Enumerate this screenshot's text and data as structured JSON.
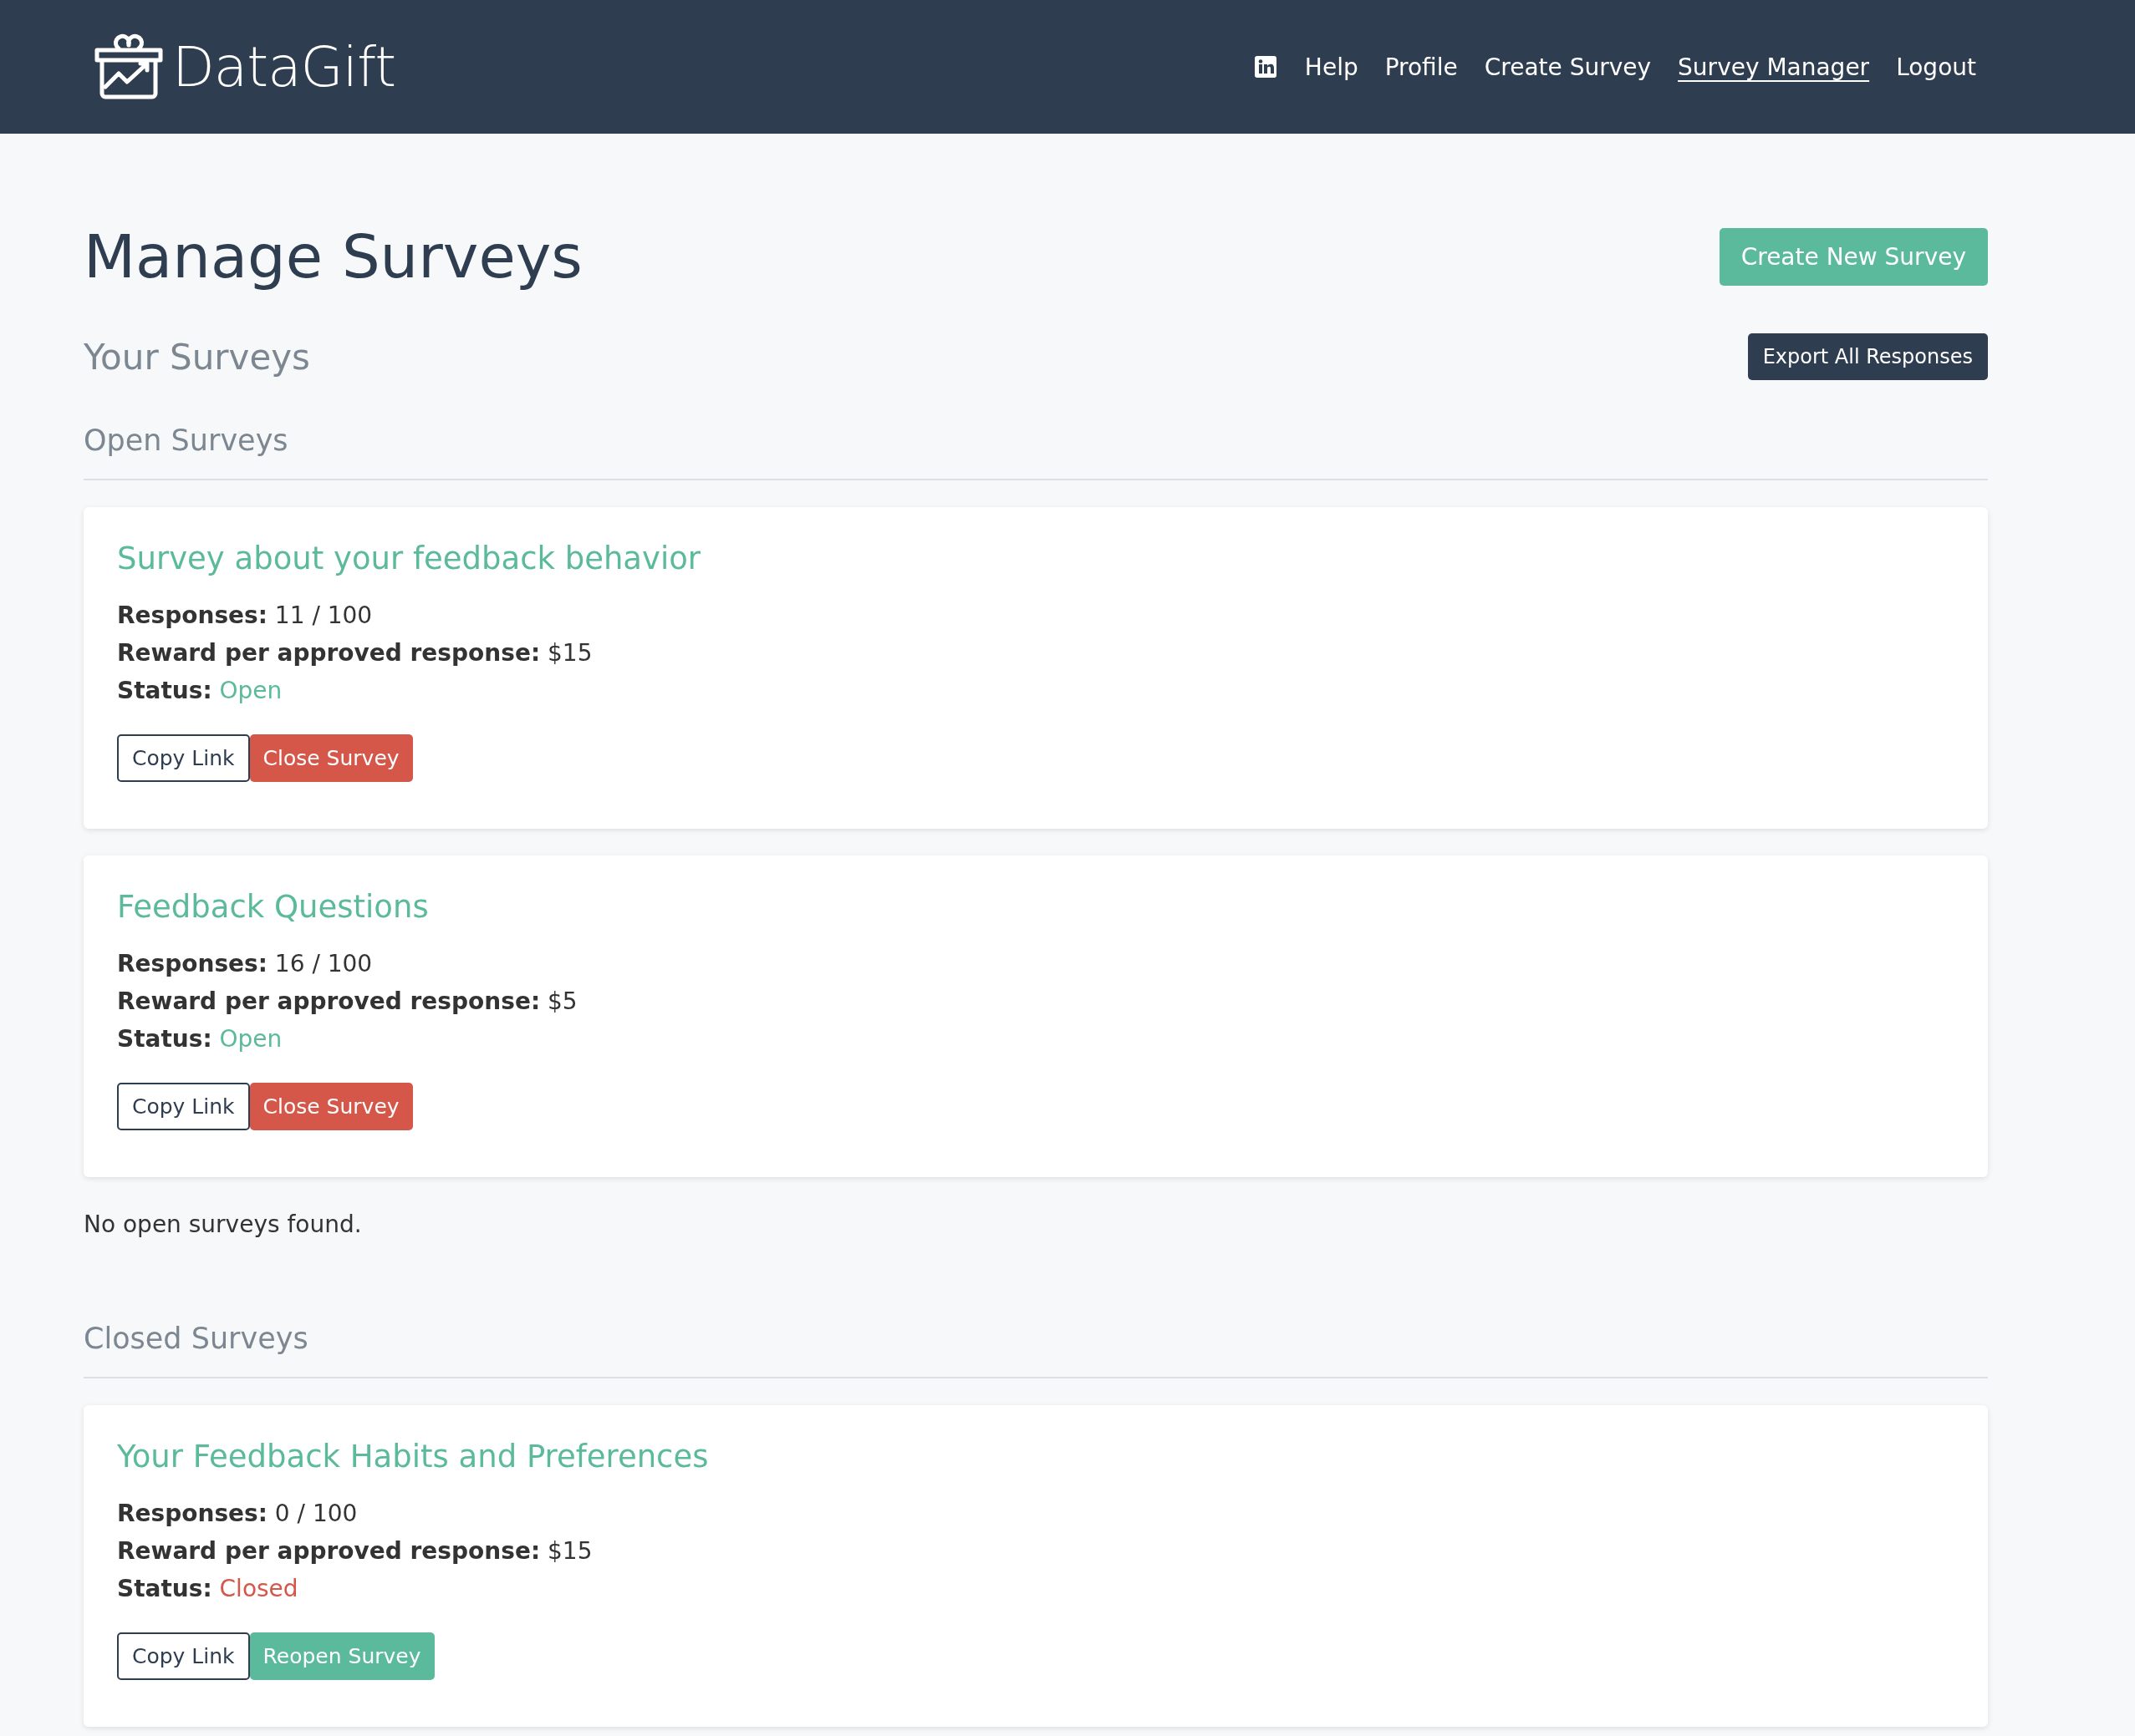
{
  "header": {
    "logo": "DataGift",
    "nav": [
      {
        "kind": "icon",
        "selected": false
      },
      {
        "label": "Help",
        "selected": false
      },
      {
        "label": "Profile",
        "selected": false
      },
      {
        "label": "Create Survey",
        "selected": false
      },
      {
        "label": "Survey Manager",
        "selected": true
      },
      {
        "label": "Logout",
        "selected": false
      }
    ]
  },
  "title": "Manage Surveys",
  "create_button": "Create New Survey",
  "subtitle": "Your Surveys",
  "export_button": "Export All Responses",
  "sections": [
    {
      "heading": "Open Surveys",
      "surveys": [
        {
          "title": "Survey about your feedback behavior",
          "fields": [
            {
              "label": "Responses:",
              "value": "11 / 100"
            },
            {
              "label": "Reward per approved response:",
              "value": "$15"
            }
          ],
          "status_label": "Status:",
          "status": {
            "text": "Open",
            "kind": "open"
          },
          "buttons": [
            {
              "label": "Copy Link",
              "kind": "outline"
            },
            {
              "label": "Close Survey",
              "kind": "danger"
            }
          ]
        },
        {
          "title": "Feedback Questions",
          "fields": [
            {
              "label": "Responses:",
              "value": "16 / 100"
            },
            {
              "label": "Reward per approved response:",
              "value": "$5"
            }
          ],
          "status_label": "Status:",
          "status": {
            "text": "Open",
            "kind": "open"
          },
          "buttons": [
            {
              "label": "Copy Link",
              "kind": "outline"
            },
            {
              "label": "Close Survey",
              "kind": "danger"
            }
          ]
        }
      ],
      "empty_message": "No open surveys found."
    },
    {
      "heading": "Closed Surveys",
      "surveys": [
        {
          "title": "Your Feedback Habits and Preferences",
          "fields": [
            {
              "label": "Responses:",
              "value": "0 / 100"
            },
            {
              "label": "Reward per approved response:",
              "value": "$15"
            }
          ],
          "status_label": "Status:",
          "status": {
            "text": "Closed",
            "kind": "closed"
          },
          "buttons": [
            {
              "label": "Copy Link",
              "kind": "outline"
            },
            {
              "label": "Reopen Survey",
              "kind": "primary"
            }
          ]
        }
      ]
    }
  ]
}
